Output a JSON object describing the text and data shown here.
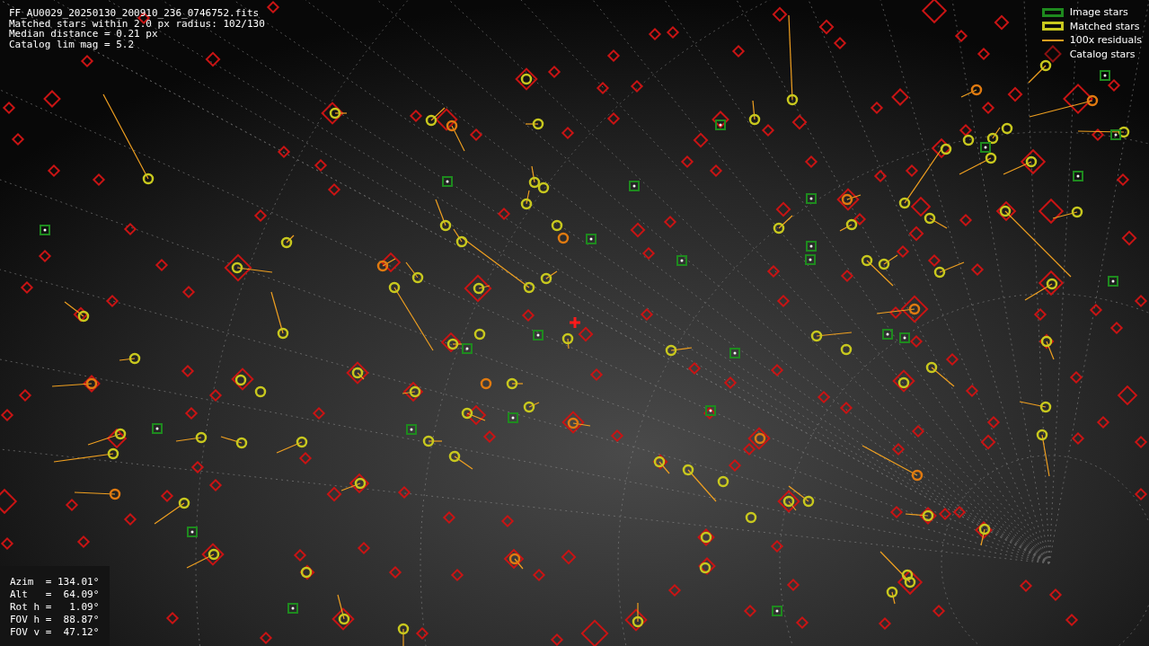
{
  "info_lines": [
    "FF_AU0029_20250130_200910_236_0746752.fits",
    "Matched stars within 2.0 px radius: 102/130",
    "Median distance = 0.21 px",
    "Catalog lim mag = 5.2"
  ],
  "legend": [
    {
      "kind": "image",
      "label": "Image stars"
    },
    {
      "kind": "matched",
      "label": "Matched stars"
    },
    {
      "kind": "residual",
      "label": "100x residuals"
    },
    {
      "kind": "catalog",
      "label": "Catalog stars"
    }
  ],
  "pointing_lines": [
    "Azim  = 134.01°",
    "Alt   =  64.09°",
    "Rot h =   1.09°",
    "FOV h =  88.87°",
    "FOV v =  47.12°"
  ]
}
